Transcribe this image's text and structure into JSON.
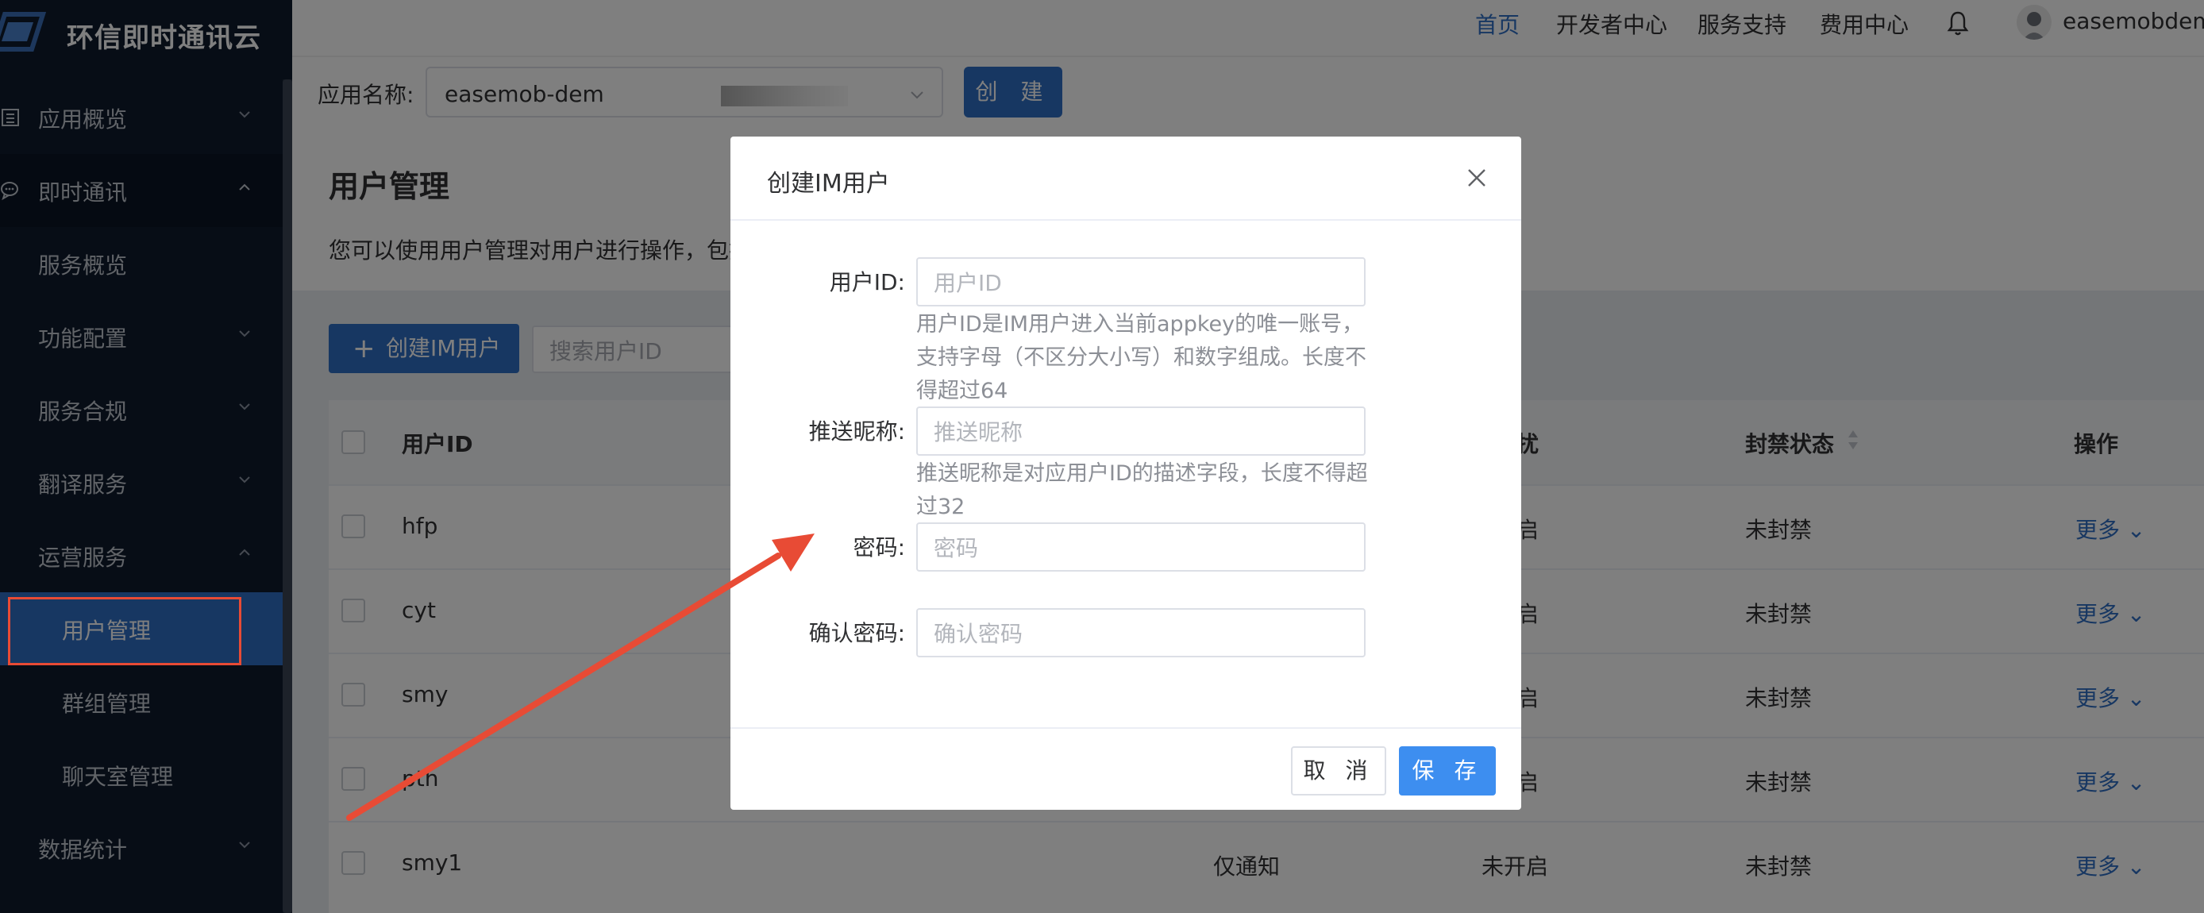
{
  "brand": {
    "name": "环信即时通讯云"
  },
  "sidebar": {
    "items": [
      {
        "label": "应用概览",
        "icon": "list-icon",
        "arrow": "down"
      },
      {
        "label": "即时通讯",
        "icon": "chat-icon",
        "arrow": "up"
      },
      {
        "label": "服务概览"
      },
      {
        "label": "功能配置",
        "arrow": "down"
      },
      {
        "label": "服务合规",
        "arrow": "down"
      },
      {
        "label": "翻译服务",
        "arrow": "down"
      },
      {
        "label": "运营服务",
        "arrow": "up"
      },
      {
        "label": "用户管理",
        "active": true
      },
      {
        "label": "群组管理"
      },
      {
        "label": "聊天室管理"
      },
      {
        "label": "数据统计",
        "arrow": "down"
      }
    ]
  },
  "topnav": {
    "items": [
      "首页",
      "开发者中心",
      "服务支持",
      "费用中心"
    ],
    "active": "首页",
    "username": "easemobdem..."
  },
  "appbar": {
    "label": "应用名称:",
    "selected_app": "easemob-dem",
    "create_label": "创 建"
  },
  "page": {
    "title": "用户管理",
    "description": "您可以使用用户管理对用户进行操作，包括"
  },
  "toolbar": {
    "create_user_label": "创建IM用户",
    "search_placeholder": "搜索用户ID"
  },
  "table": {
    "headers": {
      "user_id": "用户ID",
      "dnd": "扰",
      "ban_status": "封禁状态",
      "actions": "操作"
    },
    "rows": [
      {
        "id": "hfp",
        "push": "",
        "dnd": "启",
        "ban": "未封禁",
        "action": "更多"
      },
      {
        "id": "cyt",
        "push": "",
        "dnd": "启",
        "ban": "未封禁",
        "action": "更多"
      },
      {
        "id": "smy",
        "push": "",
        "dnd": "启",
        "ban": "未封禁",
        "action": "更多"
      },
      {
        "id": "pth",
        "push": "",
        "dnd": "启",
        "ban": "未封禁",
        "action": "更多"
      },
      {
        "id": "smy1",
        "push": "仅通知",
        "dnd": "未开启",
        "ban": "未封禁",
        "action": "更多"
      }
    ]
  },
  "modal": {
    "title": "创建IM用户",
    "fields": {
      "user_id": {
        "label": "用户ID:",
        "placeholder": "用户ID",
        "hint_lines": [
          "用户ID是IM用户进入当前appkey的唯一账号，",
          "支持字母（不区分大小写）和数字组成。长度不",
          "得超过64"
        ]
      },
      "nickname": {
        "label": "推送昵称:",
        "placeholder": "推送昵称",
        "hint_lines": [
          "推送昵称是对应用户ID的描述字段，长度不得超",
          "过32"
        ]
      },
      "password": {
        "label": "密码:",
        "placeholder": "密码"
      },
      "confirm": {
        "label": "确认密码:",
        "placeholder": "确认密码"
      }
    },
    "cancel_label": "取 消",
    "save_label": "保 存"
  },
  "colors": {
    "sidebar_bg": "#0f1b2d",
    "accent": "#2f6ec4",
    "save_button": "#3d8ef0",
    "annotation_red": "#e84b35"
  }
}
